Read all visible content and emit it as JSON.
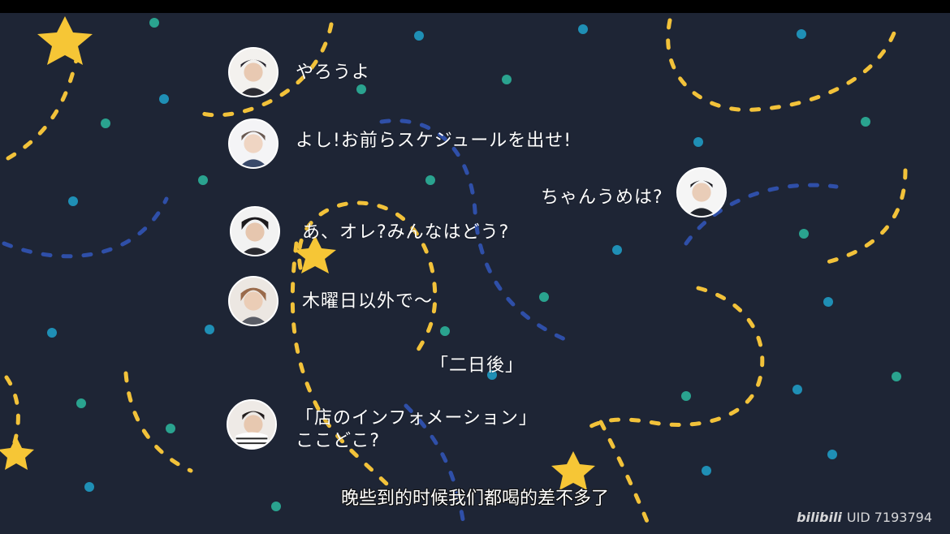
{
  "messages": [
    {
      "speaker": "member-1",
      "text": "やろうよ"
    },
    {
      "speaker": "member-2",
      "text": "よし!お前らスケジュールを出せ!"
    },
    {
      "speaker": "member-3",
      "text": "ちゃんうめは?"
    },
    {
      "speaker": "member-4",
      "text": "あ、オレ?みんなはどう?"
    },
    {
      "speaker": "member-5",
      "text": "木曜日以外で〜"
    },
    {
      "speaker": "narration",
      "text": "「二日後」"
    },
    {
      "speaker": "member-6",
      "text_line1": "「店のインフォメーション」",
      "text_line2": "ここどこ?"
    }
  ],
  "subtitle": "晚些到的时候我们都喝的差不多了",
  "watermark": {
    "logo": "bilibili",
    "uid": "UID 7193794"
  },
  "colors": {
    "background": "#1e2535",
    "dash_yellow": "#f2c23a",
    "dash_blue": "#2f4fa8",
    "dot_teal": "#2aa38f",
    "dot_blue": "#1f8fb5",
    "star": "#f6c636"
  }
}
